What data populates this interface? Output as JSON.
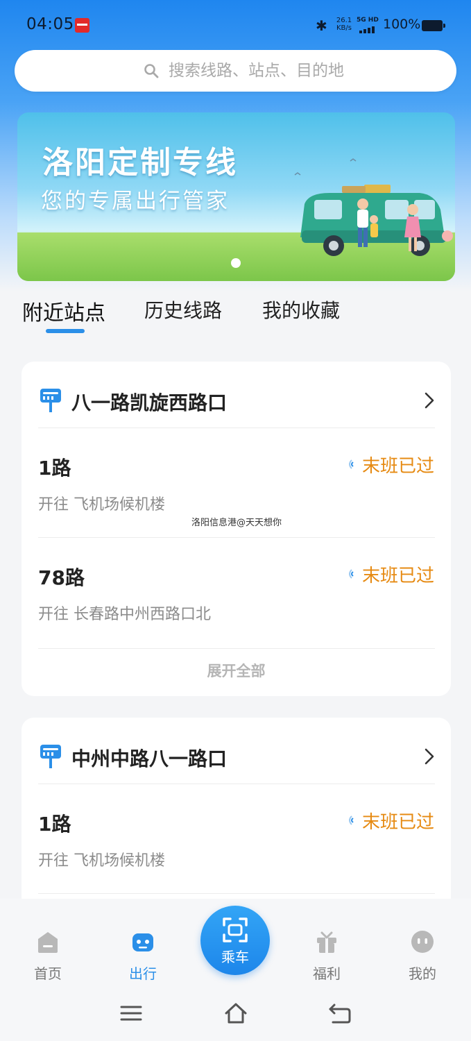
{
  "status_bar": {
    "time": "04:05",
    "net_speed_value": "26.1",
    "net_speed_unit": "KB/s",
    "signal_label": "5G HD",
    "battery": "100%"
  },
  "search": {
    "placeholder": "搜索线路、站点、目的地"
  },
  "banner": {
    "title": "洛阳定制专线",
    "subtitle": "您的专属出行管家"
  },
  "tabs": [
    {
      "label": "附近站点",
      "active": true
    },
    {
      "label": "历史线路",
      "active": false
    },
    {
      "label": "我的收藏",
      "active": false
    }
  ],
  "stops": [
    {
      "name": "八一路凯旋西路口",
      "routes": [
        {
          "name": "1路",
          "destination": "开往 飞机场候机楼",
          "status": "末班已过"
        },
        {
          "name": "78路",
          "destination": "开往 长春路中州西路口北",
          "status": "末班已过"
        }
      ],
      "expand_label": "展开全部"
    },
    {
      "name": "中州中路八一路口",
      "routes": [
        {
          "name": "1路",
          "destination": "开往 飞机场候机楼",
          "status": "末班已过"
        }
      ]
    }
  ],
  "watermark": "洛阳信息港@天天想你",
  "bottom_nav": {
    "home": "首页",
    "trip": "出行",
    "ride": "乘车",
    "welfare": "福利",
    "mine": "我的"
  },
  "colors": {
    "primary": "#2b8fe8",
    "status_orange": "#e68a12",
    "header_blue": "#1f86ef"
  }
}
